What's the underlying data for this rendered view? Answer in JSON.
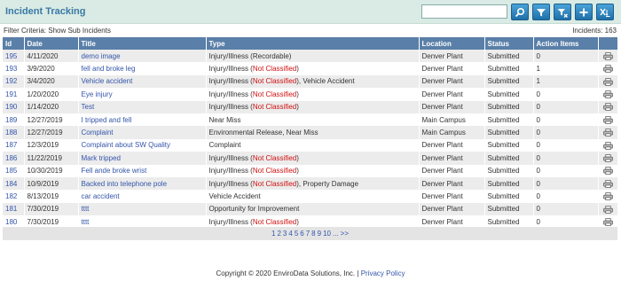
{
  "header": {
    "title": "Incident Tracking",
    "search_value": "",
    "buttons": [
      {
        "icon": "search-icon"
      },
      {
        "icon": "filter-icon"
      },
      {
        "icon": "clear-filter-icon"
      },
      {
        "icon": "add-icon"
      },
      {
        "icon": "export-excel-icon"
      }
    ]
  },
  "filter": {
    "criteria": "Filter Criteria: Show Sub Incidents",
    "count": "Incidents: 163"
  },
  "table": {
    "columns": [
      "Id",
      "Date",
      "Title",
      "Type",
      "Location",
      "Status",
      "Action Items",
      ""
    ],
    "rows": [
      {
        "id": "195",
        "date": "4/11/2020",
        "title": "demo image",
        "type": [
          "Injury/Illness (Recordable)"
        ],
        "location": "Denver Plant",
        "status": "Submitted",
        "actions": "0"
      },
      {
        "id": "193",
        "date": "3/9/2020",
        "title": "fell and broke leg",
        "type": [
          "Injury/Illness (",
          "Not Classified",
          ")"
        ],
        "location": "Denver Plant",
        "status": "Submitted",
        "actions": "1"
      },
      {
        "id": "192",
        "date": "3/4/2020",
        "title": "Vehicle accident",
        "type": [
          "Injury/Illness (",
          "Not Classified",
          "), Vehicle Accident"
        ],
        "location": "Denver Plant",
        "status": "Submitted",
        "actions": "1"
      },
      {
        "id": "191",
        "date": "1/20/2020",
        "title": "Eye injury",
        "type": [
          "Injury/Illness (",
          "Not Classified",
          ")"
        ],
        "location": "Denver Plant",
        "status": "Submitted",
        "actions": "0"
      },
      {
        "id": "190",
        "date": "1/14/2020",
        "title": "Test",
        "type": [
          "Injury/Illness (",
          "Not Classified",
          ")"
        ],
        "location": "Denver Plant",
        "status": "Submitted",
        "actions": "0"
      },
      {
        "id": "189",
        "date": "12/27/2019",
        "title": "I tripped and fell",
        "type": [
          "Near Miss"
        ],
        "location": "Main Campus",
        "status": "Submitted",
        "actions": "0"
      },
      {
        "id": "188",
        "date": "12/27/2019",
        "title": "Complaint",
        "type": [
          "Environmental Release, Near Miss"
        ],
        "location": "Main Campus",
        "status": "Submitted",
        "actions": "0"
      },
      {
        "id": "187",
        "date": "12/3/2019",
        "title": "Complaint about SW Quality",
        "type": [
          "Complaint"
        ],
        "location": "Denver Plant",
        "status": "Submitted",
        "actions": "0"
      },
      {
        "id": "186",
        "date": "11/22/2019",
        "title": "Mark tripped",
        "type": [
          "Injury/Illness (",
          "Not Classified",
          ")"
        ],
        "location": "Denver Plant",
        "status": "Submitted",
        "actions": "0"
      },
      {
        "id": "185",
        "date": "10/30/2019",
        "title": "Fell ande broke wrist",
        "type": [
          "Injury/Illness (",
          "Not Classified",
          ")"
        ],
        "location": "Denver Plant",
        "status": "Submitted",
        "actions": "0"
      },
      {
        "id": "184",
        "date": "10/9/2019",
        "title": "Backed into telephone pole",
        "type": [
          "Injury/Illness (",
          "Not Classified",
          "), Property Damage"
        ],
        "location": "Denver Plant",
        "status": "Submitted",
        "actions": "0"
      },
      {
        "id": "182",
        "date": "8/13/2019",
        "title": "car accident",
        "type": [
          "Vehicle Accident"
        ],
        "location": "Denver Plant",
        "status": "Submitted",
        "actions": "0"
      },
      {
        "id": "181",
        "date": "7/30/2019",
        "title": "tttt",
        "type": [
          "Opportunity for Improvement"
        ],
        "location": "Denver Plant",
        "status": "Submitted",
        "actions": "0"
      },
      {
        "id": "180",
        "date": "7/30/2019",
        "title": "tttt",
        "type": [
          "Injury/Illness (",
          "Not Classified",
          ")"
        ],
        "location": "Denver Plant",
        "status": "Submitted",
        "actions": "0"
      }
    ]
  },
  "pager": {
    "pages": [
      "1",
      "2",
      "3",
      "4",
      "5",
      "6",
      "7",
      "8",
      "9",
      "10",
      "...",
      ">>"
    ]
  },
  "footer": {
    "copyright": "Copyright © 2020 EnviroData Solutions, Inc. |",
    "privacy_link": "Privacy Policy"
  },
  "colors": {
    "header_bg": "#d9ebe4",
    "title": "#3a78a6",
    "table_header": "#5a7fa8",
    "link": "#3355aa",
    "not_classified": "#d01010"
  }
}
